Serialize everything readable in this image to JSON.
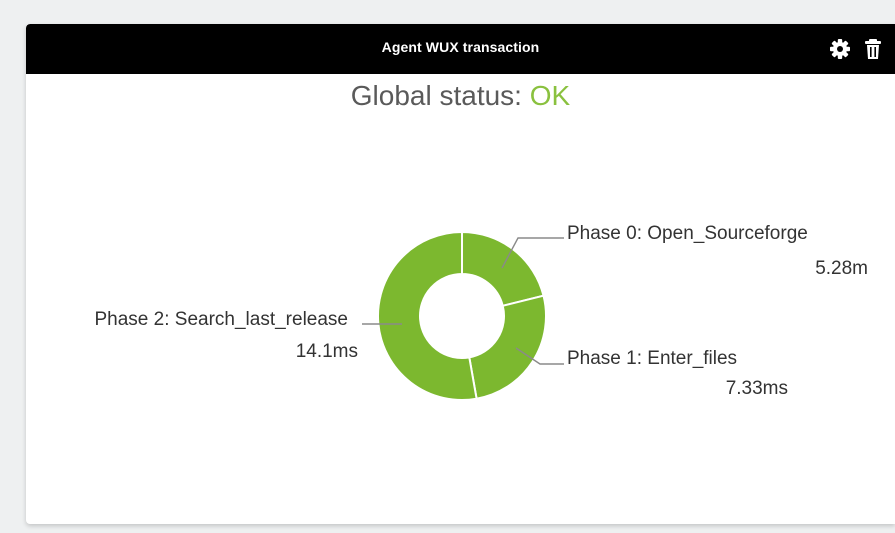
{
  "widget": {
    "title": "Agent WUX transaction",
    "icons": [
      "gear-icon",
      "trash-icon"
    ]
  },
  "status": {
    "label": "Global status: ",
    "value": "OK",
    "value_color": "#8ac13f"
  },
  "chart_data": {
    "type": "pie",
    "variant": "donut",
    "color": "#7cb82f",
    "slices": [
      {
        "name": "Phase 0: Open_Sourceforge",
        "display_value": "5.28m"
      },
      {
        "name": "Phase 1: Enter_files",
        "display_value": "7.33ms"
      },
      {
        "name": "Phase 2: Search_last_release",
        "display_value": "14.1ms"
      }
    ],
    "labels_truncated_left": true
  }
}
